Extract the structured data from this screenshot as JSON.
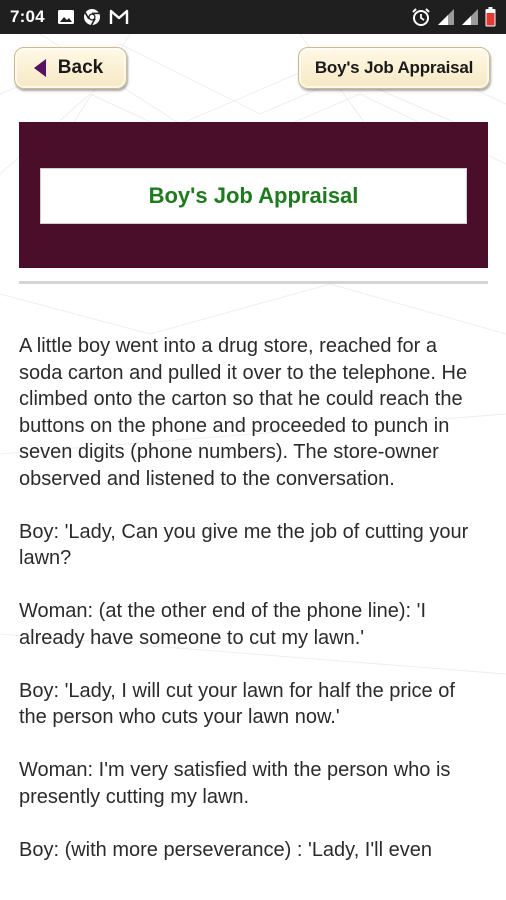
{
  "status_bar": {
    "time": "7:04",
    "left_icons": [
      "image-icon",
      "chrome-icon",
      "gmail-icon"
    ],
    "right_icons": [
      "alarm-icon",
      "signal-icon",
      "signal-icon",
      "battery-icon"
    ]
  },
  "nav": {
    "back_label": "Back",
    "title_button_label": "Boy's Job Appraisal"
  },
  "banner": {
    "title": "Boy's Job Appraisal",
    "background_color": "#4a0e2b",
    "title_color": "#1f7a1f"
  },
  "story": {
    "paragraphs": [
      "A little boy went into a drug store, reached for a soda carton and pulled it over to the telephone. He climbed onto the carton so that he could reach the buttons on the phone and proceeded to punch in seven digits (phone numbers). The store-owner observed and listened to the conversation.",
      "Boy: 'Lady, Can you give me the job of cutting your lawn?",
      "Woman: (at the other end of the phone line): 'I already have someone to cut my lawn.'",
      "Boy: 'Lady, I will cut your lawn for half the price of the person who cuts your lawn now.'",
      "Woman: I'm very satisfied with the person who is presently cutting my lawn.",
      "Boy: (with more perseverance) : 'Lady, I'll even"
    ]
  }
}
